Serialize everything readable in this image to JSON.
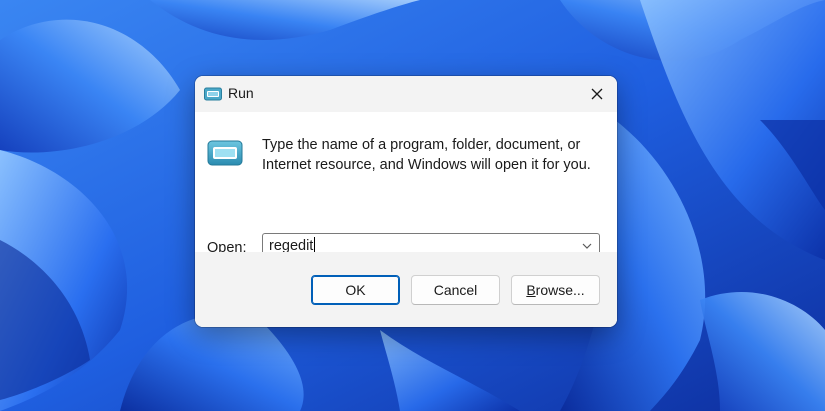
{
  "window": {
    "title": "Run",
    "icon": "run-app-icon",
    "close_icon": "close-icon"
  },
  "content": {
    "icon": "run-app-icon",
    "description_line1": "Type the name of a program, folder, document, or",
    "description_line2": "Internet resource, and Windows will open it for you.",
    "open_label_accel": "O",
    "open_label_rest": "pen:",
    "open_value": "regedit",
    "dropdown_icon": "chevron-down-icon"
  },
  "buttons": {
    "ok_label": "OK",
    "cancel_label": "Cancel",
    "browse_label_accel": "B",
    "browse_label_rest": "rowse..."
  },
  "colors": {
    "accent": "#005fb8",
    "wallpaper_base": "#1b5fe0"
  }
}
